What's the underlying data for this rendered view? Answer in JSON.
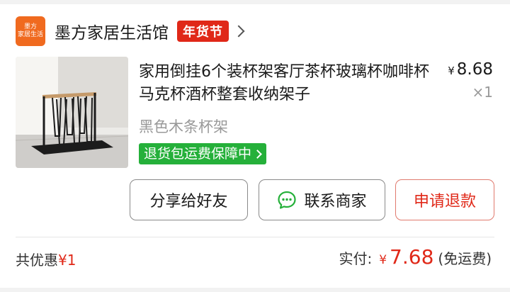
{
  "store": {
    "logo_line1": "墨方",
    "logo_line2": "家居生活",
    "name": "墨方家居生活馆",
    "badge": "年货节"
  },
  "product": {
    "title": "家用倒挂6个装杯架客厅茶杯玻璃杯咖啡杯马克杯酒杯整套收纳架子",
    "price_currency": "¥",
    "price_value": "8.68",
    "quantity": "×1",
    "spec": "黑色木条杯架",
    "guarantee": "退货包运费保障中"
  },
  "actions": {
    "share_label": "分享给好友",
    "contact_label": "联系商家",
    "refund_label": "申请退款"
  },
  "summary": {
    "discount_label": "共优惠",
    "discount_amount": "¥1",
    "paid_label": "实付:",
    "paid_currency": "¥",
    "paid_value": "7.68",
    "shipping_note": "(免运费)"
  },
  "colors": {
    "brand_orange": "#f06a1f",
    "badge_red": "#e02818",
    "guarantee_green": "#25b03a"
  },
  "icons": {
    "chevron": "chevron-right-icon",
    "chat": "chat-bubble-icon",
    "guarantee_arrow": "chevron-right-icon"
  }
}
